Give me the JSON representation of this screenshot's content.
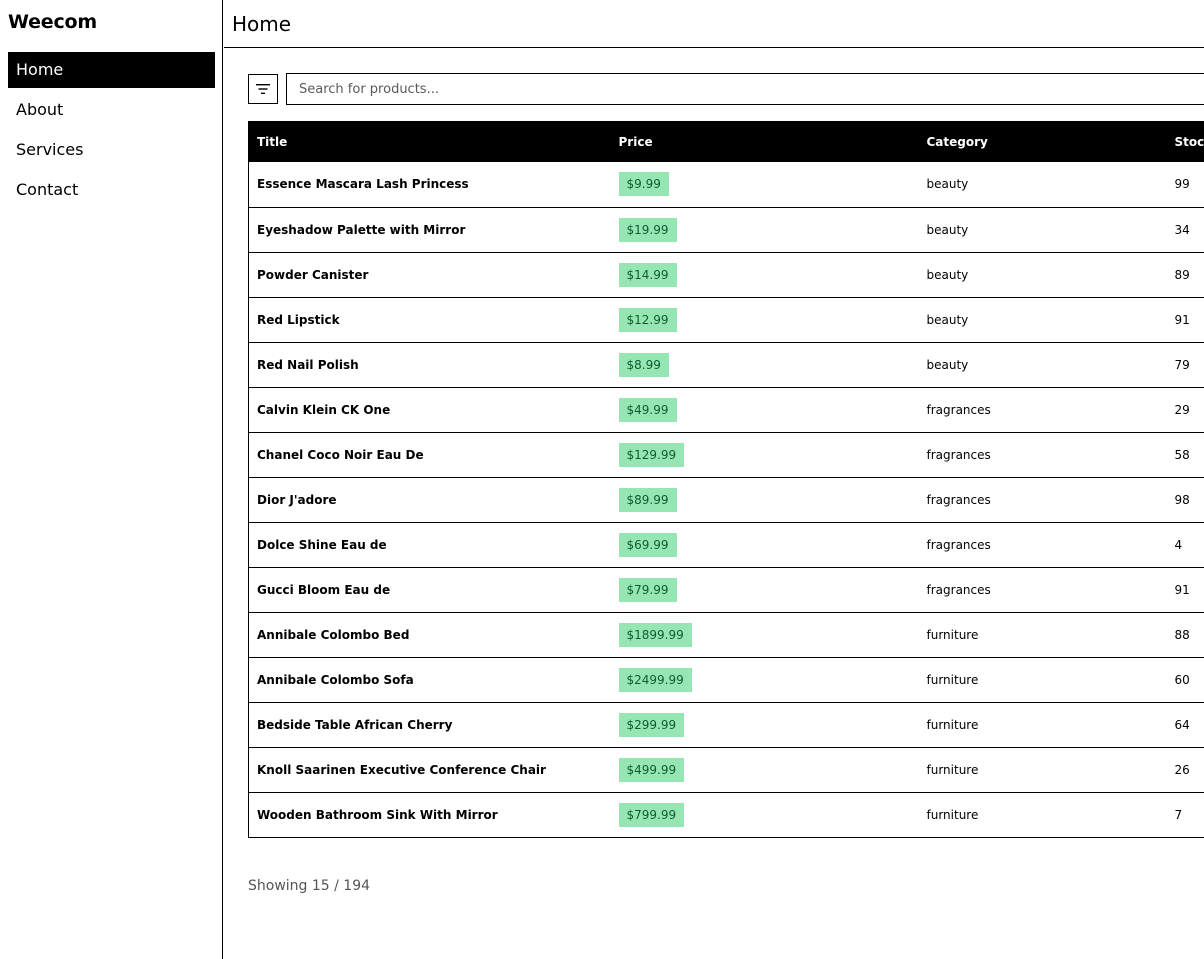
{
  "sidebar": {
    "brand": "Weecom",
    "items": [
      {
        "label": "Home",
        "active": true
      },
      {
        "label": "About",
        "active": false
      },
      {
        "label": "Services",
        "active": false
      },
      {
        "label": "Contact",
        "active": false
      }
    ]
  },
  "header": {
    "title": "Home"
  },
  "toolbar": {
    "filter_icon": "filter-icon",
    "search_placeholder": "Search for products...",
    "search_value": ""
  },
  "table": {
    "columns": [
      "Title",
      "Price",
      "Category",
      "Stock"
    ],
    "rows": [
      {
        "title": "Essence Mascara Lash Princess",
        "price": "$9.99",
        "category": "beauty",
        "stock": "99"
      },
      {
        "title": "Eyeshadow Palette with Mirror",
        "price": "$19.99",
        "category": "beauty",
        "stock": "34"
      },
      {
        "title": "Powder Canister",
        "price": "$14.99",
        "category": "beauty",
        "stock": "89"
      },
      {
        "title": "Red Lipstick",
        "price": "$12.99",
        "category": "beauty",
        "stock": "91"
      },
      {
        "title": "Red Nail Polish",
        "price": "$8.99",
        "category": "beauty",
        "stock": "79"
      },
      {
        "title": "Calvin Klein CK One",
        "price": "$49.99",
        "category": "fragrances",
        "stock": "29"
      },
      {
        "title": "Chanel Coco Noir Eau De",
        "price": "$129.99",
        "category": "fragrances",
        "stock": "58"
      },
      {
        "title": "Dior J'adore",
        "price": "$89.99",
        "category": "fragrances",
        "stock": "98"
      },
      {
        "title": "Dolce Shine Eau de",
        "price": "$69.99",
        "category": "fragrances",
        "stock": "4"
      },
      {
        "title": "Gucci Bloom Eau de",
        "price": "$79.99",
        "category": "fragrances",
        "stock": "91"
      },
      {
        "title": "Annibale Colombo Bed",
        "price": "$1899.99",
        "category": "furniture",
        "stock": "88"
      },
      {
        "title": "Annibale Colombo Sofa",
        "price": "$2499.99",
        "category": "furniture",
        "stock": "60"
      },
      {
        "title": "Bedside Table African Cherry",
        "price": "$299.99",
        "category": "furniture",
        "stock": "64"
      },
      {
        "title": "Knoll Saarinen Executive Conference Chair",
        "price": "$499.99",
        "category": "furniture",
        "stock": "26"
      },
      {
        "title": "Wooden Bathroom Sink With Mirror",
        "price": "$799.99",
        "category": "furniture",
        "stock": "7"
      }
    ]
  },
  "footer": {
    "count_text": "Showing 15 / 194"
  },
  "colors": {
    "accent": "#000000",
    "price_badge_bg": "#96e6b3",
    "price_badge_text": "#0f5c2e"
  }
}
